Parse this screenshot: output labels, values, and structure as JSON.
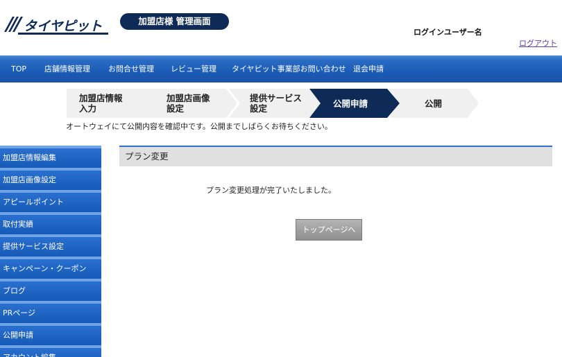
{
  "header": {
    "logo_text": "タイヤピット",
    "admin_label": "加盟店様 管理画面",
    "login_user": "ログインユーザー名",
    "logout_label": "ログアウト"
  },
  "nav": {
    "items": [
      "TOP",
      "店舗情報管理",
      "お問合せ管理",
      "レビュー管理",
      "タイヤピット事業部お問い合わせ",
      "退会申請"
    ]
  },
  "steps": {
    "items": [
      {
        "label": "加盟店情報\n入力",
        "active": false
      },
      {
        "label": "加盟店画像\n設定",
        "active": false
      },
      {
        "label": "提供サービス\n設定",
        "active": false
      },
      {
        "label": "公開申請",
        "active": true
      },
      {
        "label": "公開",
        "active": false
      }
    ],
    "message": "オートウェイにて公開内容を確認中です。公開までしばらくお待ちください。"
  },
  "sidebar": {
    "items": [
      "加盟店情報編集",
      "加盟店画像設定",
      "アピールポイント",
      "取付実績",
      "提供サービス設定",
      "キャンペーン・クーポン",
      "ブログ",
      "PRページ",
      "公開申請",
      "アカウント編集"
    ]
  },
  "main": {
    "section_title": "プラン変更",
    "message": "プラン変更処理が完了いたしました。",
    "top_button": "トップページへ"
  },
  "colors": {
    "accent": "#1a5bb5",
    "active_step": "#0e2a57",
    "step_inactive": "#f0f0f0"
  }
}
